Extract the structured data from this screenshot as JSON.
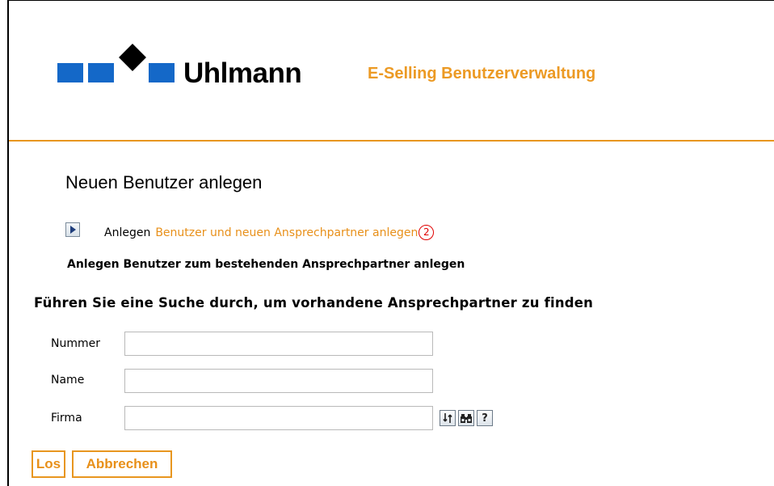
{
  "header": {
    "brand": "Uhlmann",
    "app_title": "E-Selling Benutzerverwaltung",
    "brand_color": "#1468c8",
    "accent_color": "#ec9a24"
  },
  "page": {
    "title": "Neuen Benutzer anlegen"
  },
  "create_new": {
    "label": "Anlegen",
    "link_text": "Benutzer und neuen Ansprechpartner anlegen",
    "annotation": "2"
  },
  "create_existing": {
    "text": "Anlegen Benutzer zum bestehenden Ansprechpartner anlegen"
  },
  "search": {
    "hint": "Führen Sie eine Suche durch, um vorhandene Ansprechpartner zu finden",
    "fields": [
      {
        "label": "Nummer",
        "value": ""
      },
      {
        "label": "Name",
        "value": ""
      },
      {
        "label": "Firma",
        "value": ""
      }
    ],
    "icons": [
      "refresh-icon",
      "binoculars-icon",
      "help-icon"
    ],
    "icon_glyphs": [
      "⇅",
      "🔭",
      "?"
    ]
  },
  "actions": {
    "go_label": "Los",
    "cancel_label": "Abbrechen"
  }
}
